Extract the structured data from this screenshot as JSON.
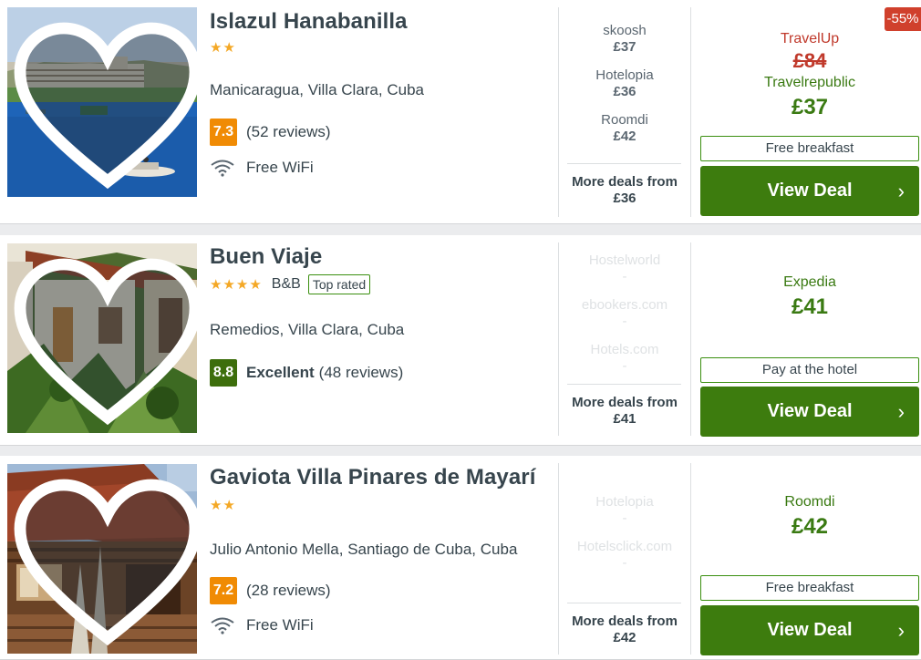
{
  "colors": {
    "accent_green": "#3d7c0e",
    "price_green": "#3a7a12",
    "discount_red": "#d0402c",
    "star_orange": "#f4a826",
    "score_orange": "#f08b04",
    "score_green": "#3d6e0c"
  },
  "hotels": [
    {
      "name": "Islazul Hanabanilla",
      "stars": "★★",
      "location": "Manicaragua, Villa Clara, Cuba",
      "score": "7.3",
      "reviews": "(52 reviews)",
      "amenity": "Free WiFi",
      "amenity_icon": "wifi-icon",
      "favorite_icon": "heart-icon",
      "deals": [
        {
          "site": "skoosh",
          "price": "£37"
        },
        {
          "site": "Hotelopia",
          "price": "£36"
        },
        {
          "site": "Roomdi",
          "price": "£42"
        }
      ],
      "more_deals_label": "More deals from",
      "more_deals_price": "£36",
      "discount": "-55%",
      "original_provider": "TravelUp",
      "original_price": "£84",
      "best_provider": "Travelrepublic",
      "best_price": "£37",
      "perk": "Free breakfast",
      "cta": "View Deal"
    },
    {
      "name": "Buen Viaje",
      "stars": "★★★★",
      "type": "B&B",
      "top_rated": "Top rated",
      "location": "Remedios, Villa Clara, Cuba",
      "score": "8.8",
      "rating_word": "Excellent",
      "reviews": "(48 reviews)",
      "favorite_icon": "heart-icon",
      "deals": [
        {
          "site": "Hostelworld",
          "price": "-"
        },
        {
          "site": "ebookers.com",
          "price": "-"
        },
        {
          "site": "Hotels.com",
          "price": "-"
        }
      ],
      "more_deals_label": "More deals from",
      "more_deals_price": "£41",
      "best_provider": "Expedia",
      "best_price": "£41",
      "perk": "Pay at the hotel",
      "cta": "View Deal"
    },
    {
      "name": "Gaviota Villa Pinares de Mayarí",
      "stars": "★★",
      "location": "Julio Antonio Mella, Santiago de Cuba, Cuba",
      "score": "7.2",
      "reviews": "(28 reviews)",
      "amenity": "Free WiFi",
      "amenity_icon": "wifi-icon",
      "favorite_icon": "heart-icon",
      "deals": [
        {
          "site": "Hotelopia",
          "price": "-"
        },
        {
          "site": "Hotelsclick.com",
          "price": "-"
        }
      ],
      "more_deals_label": "More deals from",
      "more_deals_price": "£42",
      "best_provider": "Roomdi",
      "best_price": "£42",
      "perk": "Free breakfast",
      "cta": "View Deal"
    }
  ]
}
